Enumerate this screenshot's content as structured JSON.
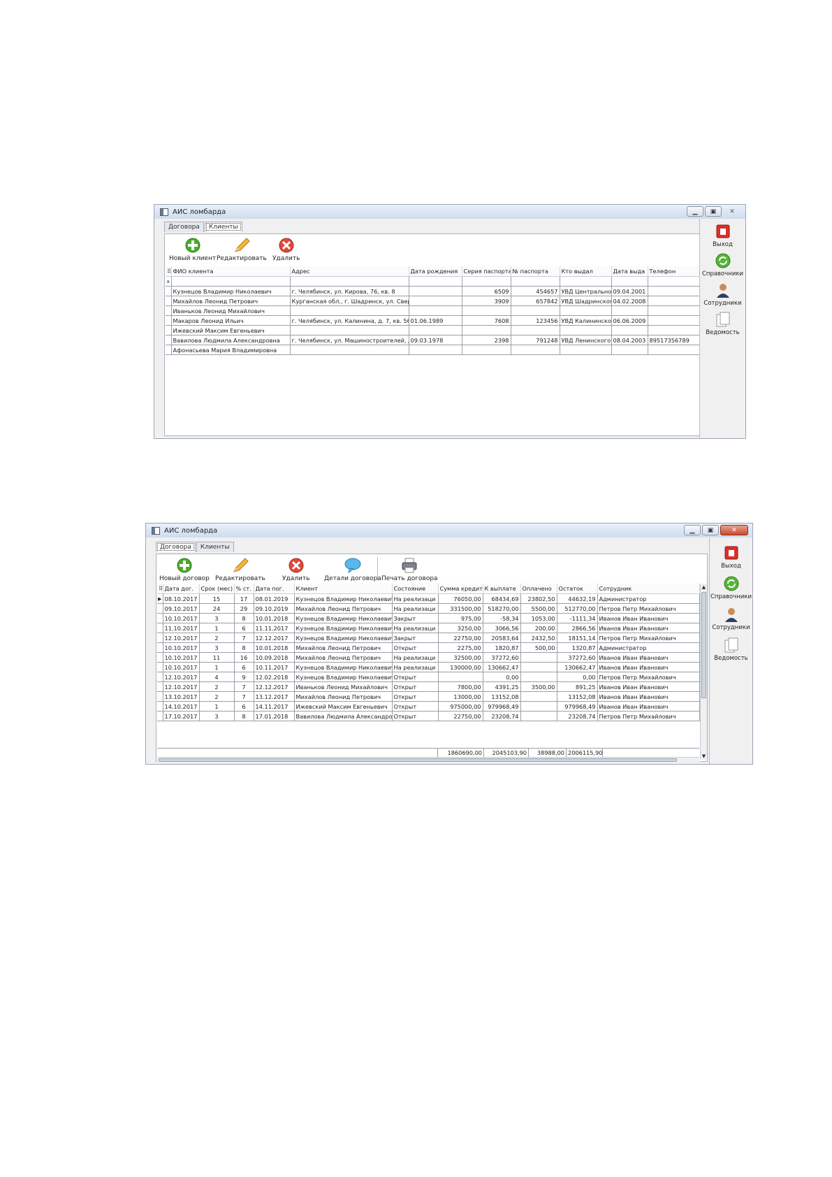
{
  "window1": {
    "title": "АИС ломбарда",
    "tabs": [
      "Договора",
      "Клиенты"
    ],
    "active_tab": "Клиенты",
    "toolbar": {
      "new_client": "Новый клиент",
      "edit": "Редактировать",
      "delete": "Удалить"
    },
    "columns": [
      "ФИО клиента",
      "Адрес",
      "Дата рождения",
      "Серия паспорта",
      "№ паспорта",
      "Кто выдал",
      "Дата выда",
      "Телефон"
    ],
    "filter_row_marker": "x",
    "rows": [
      [
        "Кузнецов Владимир Николаевич",
        "г. Челябинск, ул. Кирова, 76, кв. 8",
        "",
        "6509",
        "454657",
        "УВД Центральног",
        "09.04.2001",
        ""
      ],
      [
        "Михайлов Леонид Петрович",
        "Курганская обл., г. Шадринск, ул. Свер,",
        "",
        "3909",
        "657842",
        "УВД Шадринског",
        "04.02.2008",
        ""
      ],
      [
        "Иваньков Леонид Михайлович",
        "",
        "",
        "",
        "",
        "",
        "",
        ""
      ],
      [
        "Макаров Леонид Ильич",
        "г. Челябинск, ул. Калинина, д. 7, кв. 56",
        "01.06.1989",
        "7608",
        "123456",
        "УВД Калининског",
        "06.06.2009",
        ""
      ],
      [
        "Ижевский Максим Евгеньевич",
        "",
        "",
        "",
        "",
        "",
        "",
        ""
      ],
      [
        "Вавилова Людмила Александровна",
        "г. Челябинск, ул. Машиностроителей, д.",
        "09.03.1978",
        "2398",
        "791248",
        "УВД Ленинского р",
        "08.04.2003",
        "89517356789"
      ],
      [
        "Афонасьева Мария Владимировна",
        "",
        "",
        "",
        "",
        "",
        "",
        ""
      ]
    ]
  },
  "window2": {
    "title": "АИС ломбарда",
    "tabs": [
      "Договора",
      "Клиенты"
    ],
    "active_tab": "Договора",
    "toolbar": {
      "new_contract": "Новый договор",
      "edit": "Редактировать",
      "delete": "Удалить",
      "details": "Детали договора",
      "print": "Печать договора"
    },
    "columns": [
      "Дата дог.",
      "Срок (мес)",
      "% ст.",
      "Дата пог.",
      "Клиент",
      "Состояние",
      "Сумма кредит",
      "К выплате",
      "Оплачено",
      "Остаток",
      "Сотрудник"
    ],
    "rows": [
      [
        "08.10.2017",
        "15",
        "17",
        "08.01.2019",
        "Кузнецов Владимир Николаевич",
        "На реализаци",
        "76050,00",
        "68434,69",
        "23802,50",
        "44632,19",
        "Администратор"
      ],
      [
        "09.10.2017",
        "24",
        "29",
        "09.10.2019",
        "Михайлов Леонид Петрович",
        "На реализаци",
        "331500,00",
        "518270,00",
        "5500,00",
        "512770,00",
        "Петров Петр Михайлович"
      ],
      [
        "10.10.2017",
        "3",
        "8",
        "10.01.2018",
        "Кузнецов Владимир Николаевич",
        "Закрыт",
        "975,00",
        "-58,34",
        "1053,00",
        "-1111,34",
        "Иванов Иван Иванович"
      ],
      [
        "11.10.2017",
        "1",
        "6",
        "11.11.2017",
        "Кузнецов Владимир Николаевич",
        "На реализаци",
        "3250,00",
        "3066,56",
        "200,00",
        "2866,56",
        "Иванов Иван Иванович"
      ],
      [
        "12.10.2017",
        "2",
        "7",
        "12.12.2017",
        "Кузнецов Владимир Николаевич",
        "Закрыт",
        "22750,00",
        "20583,64",
        "2432,50",
        "18151,14",
        "Петров Петр Михайлович"
      ],
      [
        "10.10.2017",
        "3",
        "8",
        "10.01.2018",
        "Михайлов Леонид Петрович",
        "Открыт",
        "2275,00",
        "1820,87",
        "500,00",
        "1320,87",
        "Администратор"
      ],
      [
        "10.10.2017",
        "11",
        "16",
        "10.09.2018",
        "Михайлов Леонид Петрович",
        "На реализаци",
        "32500,00",
        "37272,60",
        "",
        "37272,60",
        "Иванов Иван Иванович"
      ],
      [
        "10.10.2017",
        "1",
        "6",
        "10.11.2017",
        "Кузнецов Владимир Николаевич",
        "На реализаци",
        "130000,00",
        "130662,47",
        "",
        "130662,47",
        "Иванов Иван Иванович"
      ],
      [
        "12.10.2017",
        "4",
        "9",
        "12.02.2018",
        "Кузнецов Владимир Николаевич",
        "Открыт",
        "",
        "0,00",
        "",
        "0,00",
        "Петров Петр Михайлович"
      ],
      [
        "12.10.2017",
        "2",
        "7",
        "12.12.2017",
        "Иваньков Леонид Михайлович",
        "Открыт",
        "7800,00",
        "4391,25",
        "3500,00",
        "891,25",
        "Иванов Иван Иванович"
      ],
      [
        "13.10.2017",
        "2",
        "7",
        "13.12.2017",
        "Михайлов Леонид Петрович",
        "Открыт",
        "13000,00",
        "13152,08",
        "",
        "13152,08",
        "Иванов Иван Иванович"
      ],
      [
        "14.10.2017",
        "1",
        "6",
        "14.11.2017",
        "Ижевский Максим Евгеньевич",
        "Открыт",
        "975000,00",
        "979968,49",
        "",
        "979968,49",
        "Иванов Иван Иванович"
      ],
      [
        "17.10.2017",
        "3",
        "8",
        "17.01.2018",
        "Вавилова Людмила Александровна",
        "Открыт",
        "22750,00",
        "23208,74",
        "",
        "23208,74",
        "Петров Петр Михайлович"
      ]
    ],
    "totals": {
      "credit": "1860690,00",
      "to_pay": "2045103,90",
      "paid": "38988,00",
      "remainder": "2006115,90"
    }
  },
  "sidebar": {
    "exit": "Выход",
    "directories": "Справочники",
    "employees": "Сотрудники",
    "statement": "Ведомость"
  }
}
